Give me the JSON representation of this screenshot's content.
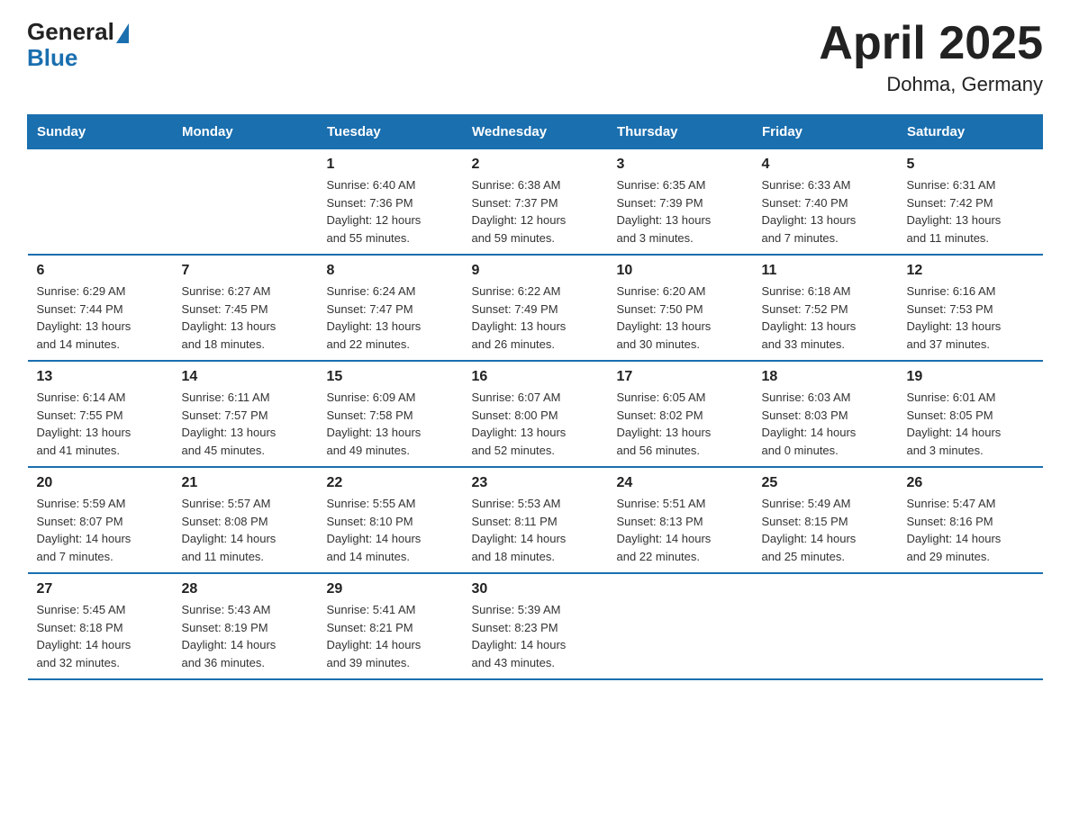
{
  "header": {
    "logo_general": "General",
    "logo_blue": "Blue",
    "title": "April 2025",
    "subtitle": "Dohma, Germany"
  },
  "days_of_week": [
    "Sunday",
    "Monday",
    "Tuesday",
    "Wednesday",
    "Thursday",
    "Friday",
    "Saturday"
  ],
  "weeks": [
    [
      {
        "day": "",
        "info": ""
      },
      {
        "day": "",
        "info": ""
      },
      {
        "day": "1",
        "info": "Sunrise: 6:40 AM\nSunset: 7:36 PM\nDaylight: 12 hours\nand 55 minutes."
      },
      {
        "day": "2",
        "info": "Sunrise: 6:38 AM\nSunset: 7:37 PM\nDaylight: 12 hours\nand 59 minutes."
      },
      {
        "day": "3",
        "info": "Sunrise: 6:35 AM\nSunset: 7:39 PM\nDaylight: 13 hours\nand 3 minutes."
      },
      {
        "day": "4",
        "info": "Sunrise: 6:33 AM\nSunset: 7:40 PM\nDaylight: 13 hours\nand 7 minutes."
      },
      {
        "day": "5",
        "info": "Sunrise: 6:31 AM\nSunset: 7:42 PM\nDaylight: 13 hours\nand 11 minutes."
      }
    ],
    [
      {
        "day": "6",
        "info": "Sunrise: 6:29 AM\nSunset: 7:44 PM\nDaylight: 13 hours\nand 14 minutes."
      },
      {
        "day": "7",
        "info": "Sunrise: 6:27 AM\nSunset: 7:45 PM\nDaylight: 13 hours\nand 18 minutes."
      },
      {
        "day": "8",
        "info": "Sunrise: 6:24 AM\nSunset: 7:47 PM\nDaylight: 13 hours\nand 22 minutes."
      },
      {
        "day": "9",
        "info": "Sunrise: 6:22 AM\nSunset: 7:49 PM\nDaylight: 13 hours\nand 26 minutes."
      },
      {
        "day": "10",
        "info": "Sunrise: 6:20 AM\nSunset: 7:50 PM\nDaylight: 13 hours\nand 30 minutes."
      },
      {
        "day": "11",
        "info": "Sunrise: 6:18 AM\nSunset: 7:52 PM\nDaylight: 13 hours\nand 33 minutes."
      },
      {
        "day": "12",
        "info": "Sunrise: 6:16 AM\nSunset: 7:53 PM\nDaylight: 13 hours\nand 37 minutes."
      }
    ],
    [
      {
        "day": "13",
        "info": "Sunrise: 6:14 AM\nSunset: 7:55 PM\nDaylight: 13 hours\nand 41 minutes."
      },
      {
        "day": "14",
        "info": "Sunrise: 6:11 AM\nSunset: 7:57 PM\nDaylight: 13 hours\nand 45 minutes."
      },
      {
        "day": "15",
        "info": "Sunrise: 6:09 AM\nSunset: 7:58 PM\nDaylight: 13 hours\nand 49 minutes."
      },
      {
        "day": "16",
        "info": "Sunrise: 6:07 AM\nSunset: 8:00 PM\nDaylight: 13 hours\nand 52 minutes."
      },
      {
        "day": "17",
        "info": "Sunrise: 6:05 AM\nSunset: 8:02 PM\nDaylight: 13 hours\nand 56 minutes."
      },
      {
        "day": "18",
        "info": "Sunrise: 6:03 AM\nSunset: 8:03 PM\nDaylight: 14 hours\nand 0 minutes."
      },
      {
        "day": "19",
        "info": "Sunrise: 6:01 AM\nSunset: 8:05 PM\nDaylight: 14 hours\nand 3 minutes."
      }
    ],
    [
      {
        "day": "20",
        "info": "Sunrise: 5:59 AM\nSunset: 8:07 PM\nDaylight: 14 hours\nand 7 minutes."
      },
      {
        "day": "21",
        "info": "Sunrise: 5:57 AM\nSunset: 8:08 PM\nDaylight: 14 hours\nand 11 minutes."
      },
      {
        "day": "22",
        "info": "Sunrise: 5:55 AM\nSunset: 8:10 PM\nDaylight: 14 hours\nand 14 minutes."
      },
      {
        "day": "23",
        "info": "Sunrise: 5:53 AM\nSunset: 8:11 PM\nDaylight: 14 hours\nand 18 minutes."
      },
      {
        "day": "24",
        "info": "Sunrise: 5:51 AM\nSunset: 8:13 PM\nDaylight: 14 hours\nand 22 minutes."
      },
      {
        "day": "25",
        "info": "Sunrise: 5:49 AM\nSunset: 8:15 PM\nDaylight: 14 hours\nand 25 minutes."
      },
      {
        "day": "26",
        "info": "Sunrise: 5:47 AM\nSunset: 8:16 PM\nDaylight: 14 hours\nand 29 minutes."
      }
    ],
    [
      {
        "day": "27",
        "info": "Sunrise: 5:45 AM\nSunset: 8:18 PM\nDaylight: 14 hours\nand 32 minutes."
      },
      {
        "day": "28",
        "info": "Sunrise: 5:43 AM\nSunset: 8:19 PM\nDaylight: 14 hours\nand 36 minutes."
      },
      {
        "day": "29",
        "info": "Sunrise: 5:41 AM\nSunset: 8:21 PM\nDaylight: 14 hours\nand 39 minutes."
      },
      {
        "day": "30",
        "info": "Sunrise: 5:39 AM\nSunset: 8:23 PM\nDaylight: 14 hours\nand 43 minutes."
      },
      {
        "day": "",
        "info": ""
      },
      {
        "day": "",
        "info": ""
      },
      {
        "day": "",
        "info": ""
      }
    ]
  ]
}
